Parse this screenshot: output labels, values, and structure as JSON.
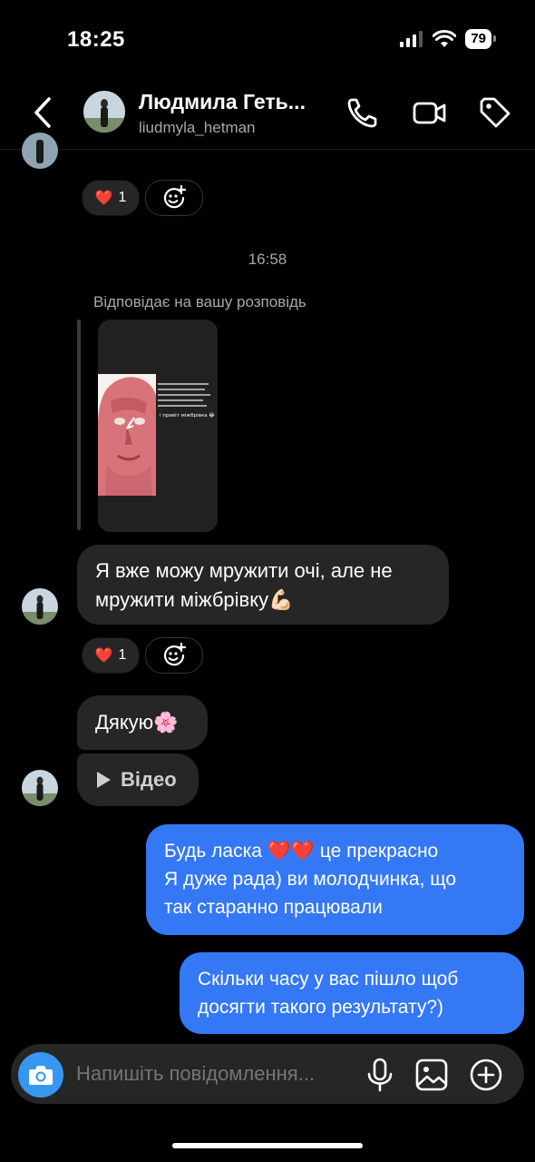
{
  "status_bar": {
    "time": "18:25",
    "battery": "79"
  },
  "header": {
    "name": "Людмила Геть...",
    "username": "liudmyla_hetman"
  },
  "messages": {
    "reaction_top": {
      "emoji": "❤️",
      "count": "1"
    },
    "timestamp": "16:58",
    "reply_label": "Відповідає на вашу розповідь",
    "story_text": "і привіт міжбрівка 😂",
    "msg1": {
      "line1": "Я вже можу мружити очі, але не",
      "line2": "мружити міжбрівку💪🏻"
    },
    "reaction_msg1": {
      "emoji": "❤️",
      "count": "1"
    },
    "msg2": "Дякую🌸",
    "msg3": "Відео",
    "out1": {
      "line1": "Будь ласка ❤️❤️ це прекрасно",
      "line2": "Я дуже рада) ви молодчинка, що",
      "line3": "так старанно працювали"
    },
    "out2": {
      "line1": "Скільки часу у вас пішло щоб",
      "line2": "досягти такого результату?)"
    }
  },
  "composer": {
    "placeholder": "Напишіть повідомлення..."
  },
  "colors": {
    "outgoing": "#3478f6",
    "incoming": "#262626",
    "camera": "#3797f0"
  }
}
